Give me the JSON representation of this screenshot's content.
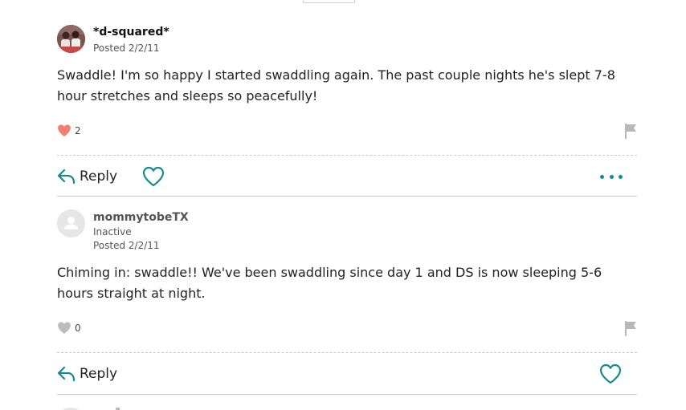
{
  "colors": {
    "accent": "#1a8a8c",
    "liked_heart": "#f08070",
    "unliked_heart": "#bdbdbd",
    "flag": "#b8b8b8"
  },
  "posts": [
    {
      "author": "*d-squared*",
      "status": "",
      "posted": "Posted 2/2/11",
      "body": "Swaddle! I'm so happy I started swaddling again. The past couple nights he's slept 7-8 hour stretches and sleeps so peacefully!",
      "like_count": "2",
      "liked": true,
      "reply_label": "Reply",
      "like_icon": "heart-outline-icon",
      "more_icon": "more-dots-icon",
      "flag_icon": "flag-icon"
    },
    {
      "author": "mommytobeTX",
      "status": "Inactive",
      "posted": "Posted 2/2/11",
      "body": "Chiming in: swaddle!!  We've been swaddling since day 1 and DS is now sleeping 5-6 hours straight at night.",
      "like_count": "0",
      "liked": false,
      "reply_label": "Reply",
      "like_icon": "heart-outline-icon",
      "flag_icon": "flag-icon"
    }
  ]
}
